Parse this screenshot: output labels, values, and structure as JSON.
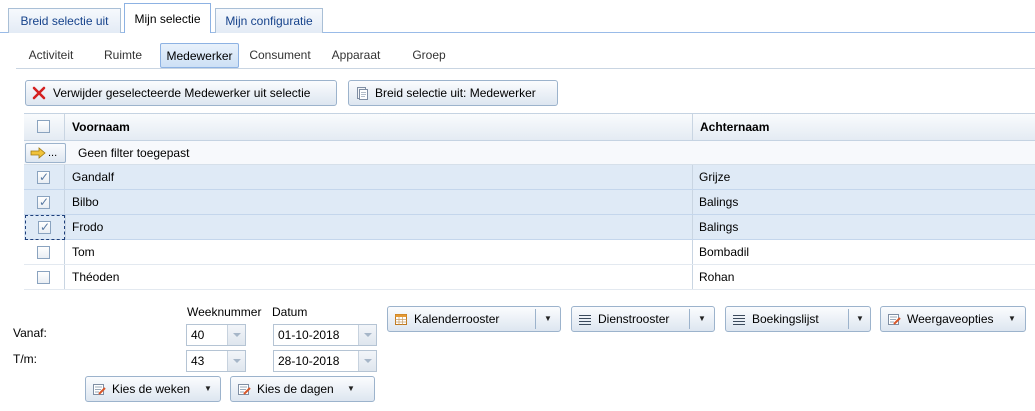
{
  "tabs": [
    {
      "label": "Breid selectie uit",
      "active": false
    },
    {
      "label": "Mijn selectie",
      "active": true
    },
    {
      "label": "Mijn configuratie",
      "active": false
    }
  ],
  "subtabs": [
    {
      "label": "Activiteit",
      "active": false
    },
    {
      "label": "Ruimte",
      "active": false
    },
    {
      "label": "Medewerker",
      "active": true
    },
    {
      "label": "Consument",
      "active": false
    },
    {
      "label": "Apparaat",
      "active": false
    },
    {
      "label": "Groep",
      "active": false
    }
  ],
  "toolbar": {
    "remove_label": "Verwijder geselecteerde Medewerker uit selectie",
    "extend_label": "Breid selectie uit: Medewerker"
  },
  "grid": {
    "columns": [
      "Voornaam",
      "Achternaam"
    ],
    "filter_text": "Geen filter toegepast",
    "filter_button_label": "...",
    "rows": [
      {
        "first": "Gandalf",
        "last": "Grijze",
        "checked": true
      },
      {
        "first": "Bilbo",
        "last": "Balings",
        "checked": true
      },
      {
        "first": "Frodo",
        "last": "Balings",
        "checked": true
      },
      {
        "first": "Tom",
        "last": "Bombadil",
        "checked": false
      },
      {
        "first": "Théoden",
        "last": "Rohan",
        "checked": false
      }
    ]
  },
  "period": {
    "weeknummer_label": "Weeknummer",
    "datum_label": "Datum",
    "vanaf_label": "Vanaf:",
    "tm_label": "T/m:",
    "vanaf_week": "40",
    "vanaf_datum": "01-10-2018",
    "tm_week": "43",
    "tm_datum": "28-10-2018",
    "kies_weken": "Kies de weken",
    "kies_dagen": "Kies de dagen"
  },
  "reports": {
    "kalender": "Kalenderrooster",
    "dienst": "Dienstrooster",
    "boekings": "Boekingslijst",
    "weergave": "Weergaveopties"
  },
  "colors": {
    "accent_border": "#8db2e3",
    "selected_row": "#dfeaf6",
    "remove_icon": "#d42020"
  }
}
